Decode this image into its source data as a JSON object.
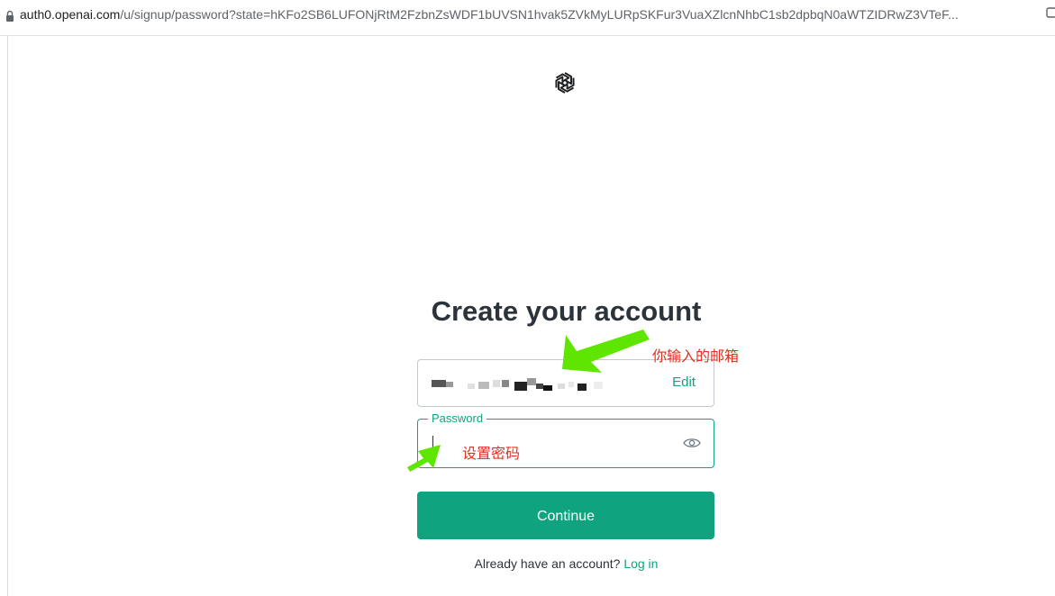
{
  "browser": {
    "url_host": "auth0.openai.com",
    "url_path": "/u/signup/password?state=hKFo2SB6LUFONjRtM2FzbnZsWDF1bUVSN1hvak5ZVkMyLURpSKFur3VuaXZlcnNhbC1sb2dpbqN0aWTZIDRwZ3VTeF..."
  },
  "logo": {
    "icon": "openai-logo-icon"
  },
  "form": {
    "title": "Create your account",
    "email_value_masked": "",
    "edit_label": "Edit",
    "password_label": "Password",
    "password_value": "",
    "password_toggle_icon": "eye-icon",
    "continue_label": "Continue",
    "login_prompt": "Already have an account?",
    "login_link": "Log in"
  },
  "annotations": {
    "email_note": "你输入的邮箱",
    "password_note": "设置密码",
    "arrow_color": "#5fe600",
    "note_color": "#e0301e"
  },
  "colors": {
    "accent": "#10a37f",
    "text": "#2d333a"
  }
}
